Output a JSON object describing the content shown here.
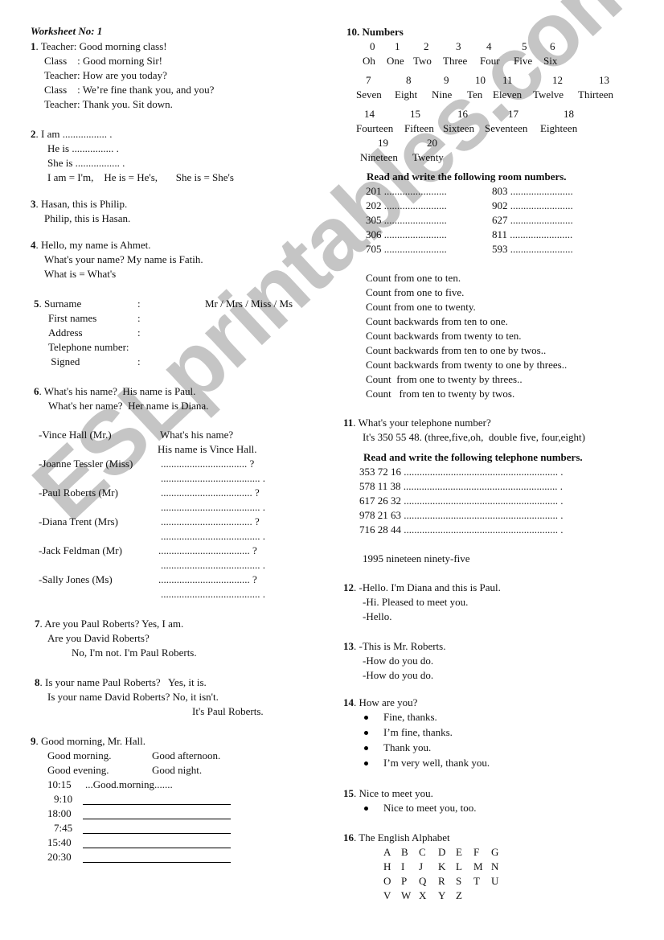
{
  "title": "Worksheet No: 1",
  "watermark": "ESLprintables.com",
  "s1": {
    "num": "1",
    "lines": [
      "Teacher: Good morning class!",
      "Class    : Good morning Sir!",
      "Teacher: How are you today?",
      "Class    : We’re fine thank you, and you?",
      "Teacher: Thank you. Sit down."
    ]
  },
  "s2": {
    "num": "2",
    "lines": [
      "I am ................. .",
      "He is ................ .",
      "She is ................. .",
      "I am = I'm,    He is = He's,       She is = She's"
    ]
  },
  "s3": {
    "num": "3",
    "lines": [
      "Hasan, this is Philip.",
      "Philip, this is Hasan."
    ]
  },
  "s4": {
    "num": "4",
    "lines": [
      "Hello, my name is Ahmet.",
      "What's your name? My name is Fatih.",
      "What is = What's"
    ]
  },
  "s5": {
    "num": "5",
    "fields": [
      {
        "label": "Surname",
        "colon": ":"
      },
      {
        "label": "First names",
        "colon": ":"
      },
      {
        "label": "Address",
        "colon": ":"
      },
      {
        "label": "Telephone number:",
        "colon": ""
      },
      {
        "label": " Signed",
        "colon": ":"
      }
    ],
    "titles": "Mr / Mrs / Miss / Ms"
  },
  "s6": {
    "num": "6",
    "lines": [
      "What's his name?  His name is Paul.",
      "What's her name?  Her name is Diana."
    ],
    "example": {
      "name": "-Vince Hall (Mr.)",
      "q": "What's his name?",
      "a": "His name is Vince Hall."
    },
    "people": [
      {
        "name": "-Joanne Tessler (Miss)",
        "q": "................................. ?",
        "a": "...................................... ."
      },
      {
        "name": "-Paul Roberts (Mr)",
        "q": "................................... ?",
        "a": "...................................... ."
      },
      {
        "name": "-Diana Trent (Mrs)",
        "q": "................................... ?",
        "a": "...................................... ."
      },
      {
        "name": "-Jack Feldman (Mr)",
        "q": "................................... ?",
        "a": "...................................... ."
      },
      {
        "name": "-Sally Jones (Ms)",
        "q": "................................... ?",
        "a": "...................................... ."
      }
    ]
  },
  "s7": {
    "num": "7",
    "lines": [
      "Are you Paul Roberts? Yes, I am.",
      "Are you David Roberts?",
      "No, I'm not. I'm Paul Roberts."
    ]
  },
  "s8": {
    "num": "8",
    "lines": [
      "Is your name Paul Roberts?   Yes, it is.",
      "Is your name David Roberts? No, it isn't.",
      "It's Paul Roberts."
    ]
  },
  "s9": {
    "num": "9",
    "head": "Good morning, Mr. Hall.",
    "greetings": [
      "Good morning.",
      "Good afternoon.",
      "Good evening.",
      "Good night."
    ],
    "example_time": "10:15",
    "example_answer": "...Good.morning.......",
    "times": [
      "9:10",
      "18:00",
      "7:45",
      "15:40",
      "20:30"
    ]
  },
  "s10": {
    "num": "10. Numbers",
    "row1": [
      [
        "0",
        "Oh"
      ],
      [
        "1",
        "One"
      ],
      [
        "2",
        "Two"
      ],
      [
        "3",
        "Three"
      ],
      [
        "4",
        "Four"
      ],
      [
        "5",
        "Five"
      ],
      [
        "6",
        "Six"
      ]
    ],
    "row2": [
      [
        "7",
        "Seven"
      ],
      [
        "8",
        "Eight"
      ],
      [
        "9",
        "Nine"
      ],
      [
        "10",
        "Ten"
      ],
      [
        "11",
        "Eleven"
      ],
      [
        "12",
        "Twelve"
      ],
      [
        "13",
        "Thirteen"
      ]
    ],
    "row3": [
      [
        "14",
        "Fourteen"
      ],
      [
        "15",
        "Fifteen"
      ],
      [
        "16",
        "Sixteen"
      ],
      [
        "17",
        "Seventeen"
      ],
      [
        "18",
        "Eighteen"
      ]
    ],
    "row4": [
      [
        "19",
        "Nineteen"
      ],
      [
        "20",
        "Twenty"
      ]
    ],
    "room_heading": "Read and write the following room numbers.",
    "rooms_left": [
      "201 ........................",
      "202 ........................",
      "305 ........................",
      "306 ........................",
      "705 ........................"
    ],
    "rooms_right": [
      "803 ........................",
      "902 ........................",
      "627 ........................",
      "811 ........................",
      "593 ........................"
    ],
    "counts": [
      "Count from one to ten.",
      "Count from one to five.",
      "Count from one to twenty.",
      "Count backwards from ten to one.",
      "Count backwards from twenty to ten.",
      "Count backwards from ten to one by twos..",
      "Count backwards from twenty to one by threes..",
      "Count  from one to twenty by threes..",
      "Count   from ten to twenty by twos."
    ]
  },
  "s11": {
    "num": "11",
    "lines": [
      "What's your telephone number?",
      "It's 350 55 48. (three,five,oh,  double five, four,eight)"
    ],
    "heading": "Read and write the following telephone numbers.",
    "phones": [
      "353 72 16 ........................................................... .",
      "578 11 38 ........................................................... .",
      "617 26 32 ........................................................... .",
      "978 21 63 ........................................................... .",
      "716 28 44 ........................................................... ."
    ],
    "year": "1995 nineteen ninety-five"
  },
  "s12": {
    "num": "12",
    "lines": [
      "-Hello. I'm Diana and this is Paul.",
      "-Hi. Pleased to meet you.",
      "-Hello."
    ]
  },
  "s13": {
    "num": "13",
    "lines": [
      "-This is Mr. Roberts.",
      "-How do you do.",
      "-How do you do."
    ]
  },
  "s14": {
    "num": "14",
    "head": "How are you?",
    "bullets": [
      "Fine, thanks.",
      "I’m fine, thanks.",
      "Thank you.",
      "I’m very well, thank you."
    ]
  },
  "s15": {
    "num": "15",
    "head": "Nice to meet you.",
    "bullets": [
      "Nice to meet you, too."
    ]
  },
  "s16": {
    "num": "16",
    "head": "The English Alphabet",
    "rows": [
      [
        "A",
        "B",
        "C",
        "D",
        "E",
        "F",
        "G"
      ],
      [
        "H",
        "I",
        "J",
        "K",
        "L",
        "M",
        "N"
      ],
      [
        "O",
        "P",
        "Q",
        "R",
        "S",
        "T",
        "U"
      ],
      [
        "V",
        "W",
        "X",
        "Y",
        "Z"
      ]
    ]
  }
}
